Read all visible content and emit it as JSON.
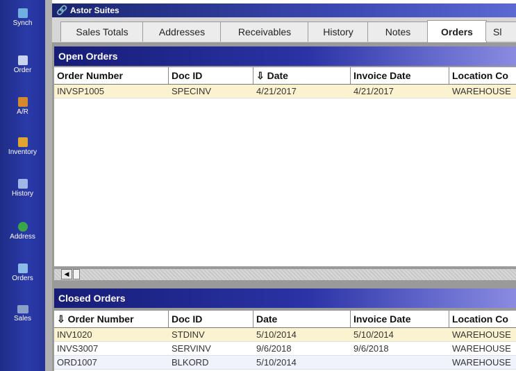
{
  "window": {
    "title": "Astor Suites"
  },
  "sidebar": {
    "items": [
      {
        "label": "Synch",
        "icon": "sync-icon",
        "color": "#6fb0e0"
      },
      {
        "label": "Order",
        "icon": "order-icon",
        "color": "#c9d4f0"
      },
      {
        "label": "A/R",
        "icon": "receivables-icon",
        "color": "#d48a2c"
      },
      {
        "label": "Inventory",
        "icon": "inventory-icon",
        "color": "#e0a530"
      },
      {
        "label": "History",
        "icon": "history-icon",
        "color": "#9fb8e8"
      },
      {
        "label": "Address",
        "icon": "address-icon",
        "color": "#3aa64a"
      },
      {
        "label": "Orders",
        "icon": "orders-icon",
        "color": "#8bbbe8"
      },
      {
        "label": "Sales",
        "icon": "sales-icon",
        "color": "#8aa0c8"
      }
    ]
  },
  "tabs": [
    {
      "label": "Sales Totals",
      "active": false
    },
    {
      "label": "Addresses",
      "active": false
    },
    {
      "label": "Receivables",
      "active": false
    },
    {
      "label": "History",
      "active": false
    },
    {
      "label": "Notes",
      "active": false
    },
    {
      "label": "Orders",
      "active": true
    },
    {
      "label": "Sl",
      "active": false
    }
  ],
  "open_orders": {
    "title": "Open Orders",
    "columns": [
      "Order Number",
      "Doc ID",
      "⇩ Date",
      "Invoice Date",
      "Location Co"
    ],
    "rows": [
      {
        "order_number": "INVSP1005",
        "doc_id": "SPECINV",
        "date": "4/21/2017",
        "invoice_date": "4/21/2017",
        "location": "WAREHOUSE"
      }
    ]
  },
  "closed_orders": {
    "title": "Closed Orders",
    "columns": [
      "⇩ Order Number",
      "Doc ID",
      "Date",
      "Invoice Date",
      "Location Co"
    ],
    "rows": [
      {
        "order_number": "INV1020",
        "doc_id": "STDINV",
        "date": "5/10/2014",
        "invoice_date": "5/10/2014",
        "location": "WAREHOUSE"
      },
      {
        "order_number": "INVS3007",
        "doc_id": "SERVINV",
        "date": "9/6/2018",
        "invoice_date": "9/6/2018",
        "location": "WAREHOUSE"
      },
      {
        "order_number": "ORD1007",
        "doc_id": "BLKORD",
        "date": "5/10/2014",
        "invoice_date": "",
        "location": "WAREHOUSE"
      }
    ]
  },
  "colors": {
    "selected_row": "#fbf3cf",
    "alt_row": "#f0f3fb",
    "header_gradient_start": "#161d77"
  }
}
